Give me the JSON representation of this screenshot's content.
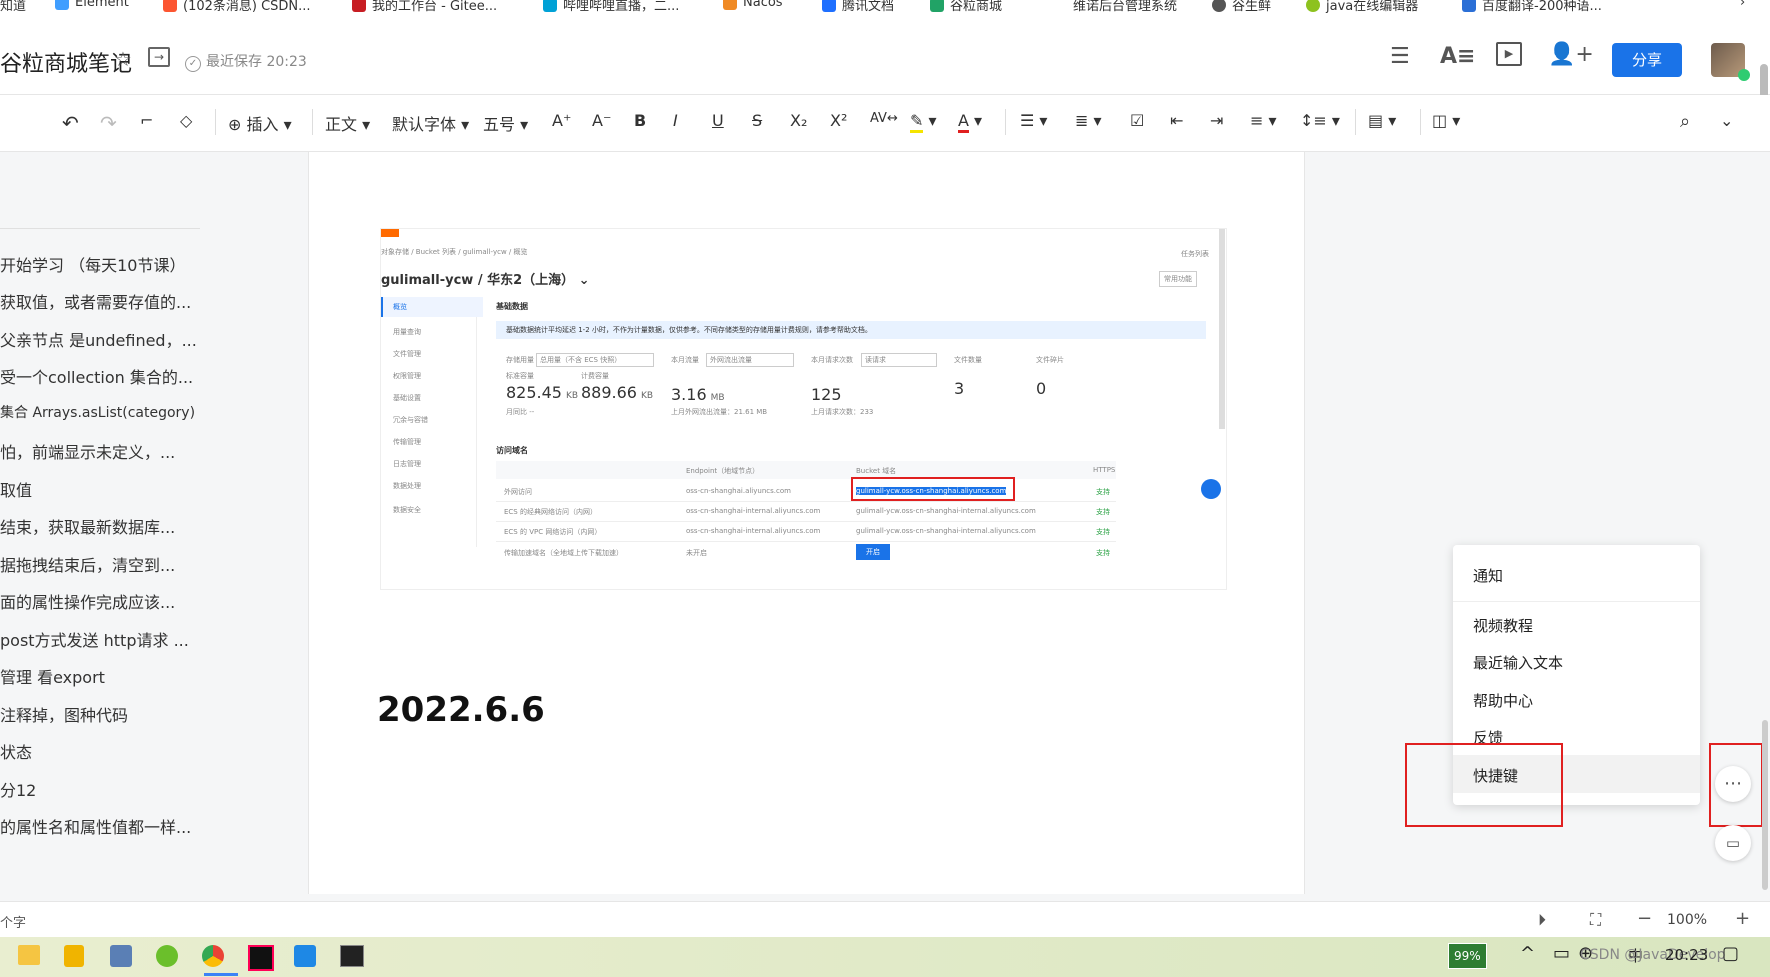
{
  "bookmarks": [
    {
      "label": "知道",
      "color": "#2b6fd6"
    },
    {
      "label": "Element",
      "color": "#409eff"
    },
    {
      "label": "(102条消息) CSDN...",
      "color": "#fc5531"
    },
    {
      "label": "我的工作台 - Gitee...",
      "color": "#c71d23"
    },
    {
      "label": "哔哩哔哩直播，二...",
      "color": "#00a1d6"
    },
    {
      "label": "Nacos",
      "color": "#f08a24"
    },
    {
      "label": "腾讯文档",
      "color": "#1e6fff"
    },
    {
      "label": "谷粒商城",
      "color": "#21a366"
    },
    {
      "label": "维诺后台管理系统",
      "color": "#ffffff"
    },
    {
      "label": "谷生鲜",
      "color": "#555555"
    },
    {
      "label": "java在线编辑器",
      "color": "#8dc21f"
    },
    {
      "label": "百度翻译-200种语...",
      "color": "#2b6fd6"
    }
  ],
  "title": {
    "doc": "谷粒商城笔记",
    "saved": "最近保存 20:23",
    "share": "分享"
  },
  "toolbar": {
    "insert": "插入",
    "style": "正文",
    "font": "默认字体",
    "size": "五号",
    "bold": "B",
    "italic": "I",
    "underline": "U",
    "strike": "S",
    "sub": "X₂",
    "sup": "X²"
  },
  "outline": [
    "开始学习 （每天10节课）",
    "获取值，或者需要存值的...",
    "父亲节点 是undefined，...",
    "受一个collection 集合的...",
    "集合 Arrays.asList(category)",
    "怕，前端显示未定义，...",
    "取值",
    "结束，获取最新数据库...",
    "据拖拽结束后，清空到...",
    "面的属性操作完成应该...",
    "post方式发送 http请求 ...",
    "管理 看export",
    "注释掉，图种代码",
    "状态",
    "分12",
    "的属性名和属性值都一样..."
  ],
  "shot": {
    "breadcrumb": "对象存储 / Bucket 列表 / gulimall-ycw / 概览",
    "task_list": "任务列表",
    "bucket_title": "gulimall-ycw / 华东2（上海）",
    "common_func": "常用功能",
    "side": [
      "概览",
      "用量查询",
      "文件管理",
      "权限管理",
      "基础设置",
      "冗余与容错",
      "传输管理",
      "日志管理",
      "数据处理",
      "数据安全"
    ],
    "basic_data": "基础数据",
    "notice": "基础数据统计平均延迟 1-2 小时，不作为计量数据，仅供参考。不同存储类型的存储用量计费规则，请参考帮助文档。",
    "stats": [
      {
        "label": "存储用量",
        "sel": "总用量（不含 ECS 快照）",
        "sub1": "标准容量",
        "val1": "825.45",
        "unit1": "KB",
        "sub2": "计费容量",
        "val2": "889.66",
        "unit2": "KB",
        "foot": "月同比 --"
      },
      {
        "label": "本月流量",
        "sel": "外网流出流量",
        "val": "3.16",
        "unit": "MB",
        "foot": "上月外网流出流量：21.61 MB"
      },
      {
        "label": "本月请求次数",
        "sel": "读请求",
        "val": "125",
        "unit": "",
        "foot": "上月请求次数：233"
      },
      {
        "label": "文件数量",
        "val": "3"
      },
      {
        "label": "文件碎片",
        "val": "0"
      }
    ],
    "domain_title": "访问域名",
    "table_head": [
      "",
      "Endpoint（地域节点）",
      "Bucket 域名",
      "HTTPS"
    ],
    "rows": [
      [
        "外网访问",
        "oss-cn-shanghai.aliyuncs.com",
        "gulimall-ycw.oss-cn-shanghai.aliyuncs.com",
        "支持"
      ],
      [
        "ECS 的经典网络访问（内网）",
        "oss-cn-shanghai-internal.aliyuncs.com",
        "gulimall-ycw.oss-cn-shanghai-internal.aliyuncs.com",
        "支持"
      ],
      [
        "ECS 的 VPC 网络访问（内网）",
        "oss-cn-shanghai-internal.aliyuncs.com",
        "gulimall-ycw.oss-cn-shanghai-internal.aliyuncs.com",
        "支持"
      ],
      [
        "传输加速域名（全地域上传下载加速）",
        "未开启",
        "开启",
        "支持"
      ]
    ]
  },
  "heading": "2022.6.6",
  "menu": [
    "通知",
    "视频教程",
    "最近输入文本",
    "帮助中心",
    "反馈",
    "快捷键"
  ],
  "status": {
    "words": "个字",
    "zoom": "100%"
  },
  "taskbar": {
    "battery": "99%",
    "ime": "中",
    "time": "20:23",
    "watermark": "CSDN @JavaDevelop"
  }
}
